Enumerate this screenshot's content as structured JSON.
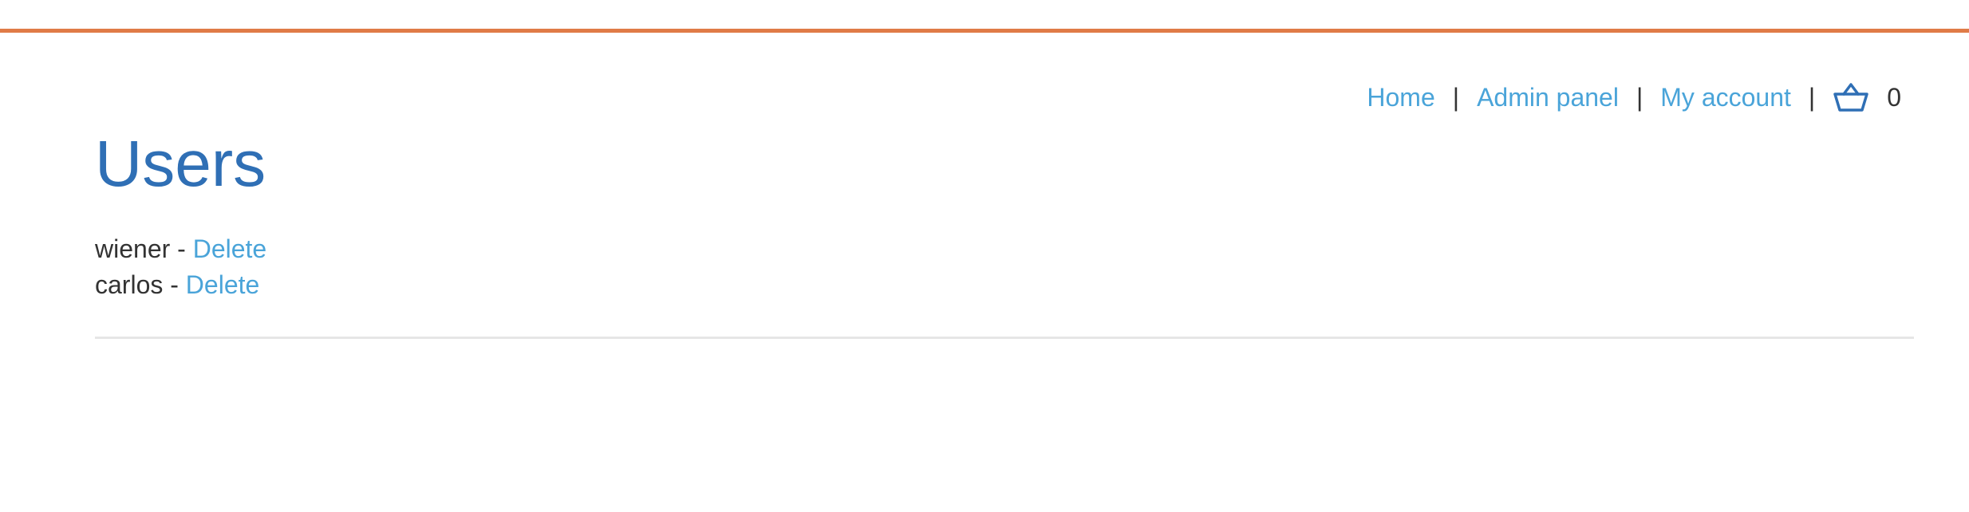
{
  "colors": {
    "accent_bar": "#e07b47",
    "title": "#2f6fb5",
    "link": "#4aa4d9",
    "text": "#333333",
    "divider": "#e6e6e6"
  },
  "nav": {
    "home": "Home",
    "admin_panel": "Admin panel",
    "my_account": "My account",
    "separator": "|",
    "cart_icon": "basket-icon",
    "cart_count": "0"
  },
  "page": {
    "title": "Users"
  },
  "users": [
    {
      "name": "wiener",
      "dash": " - ",
      "action": "Delete"
    },
    {
      "name": "carlos",
      "dash": " - ",
      "action": "Delete"
    }
  ]
}
